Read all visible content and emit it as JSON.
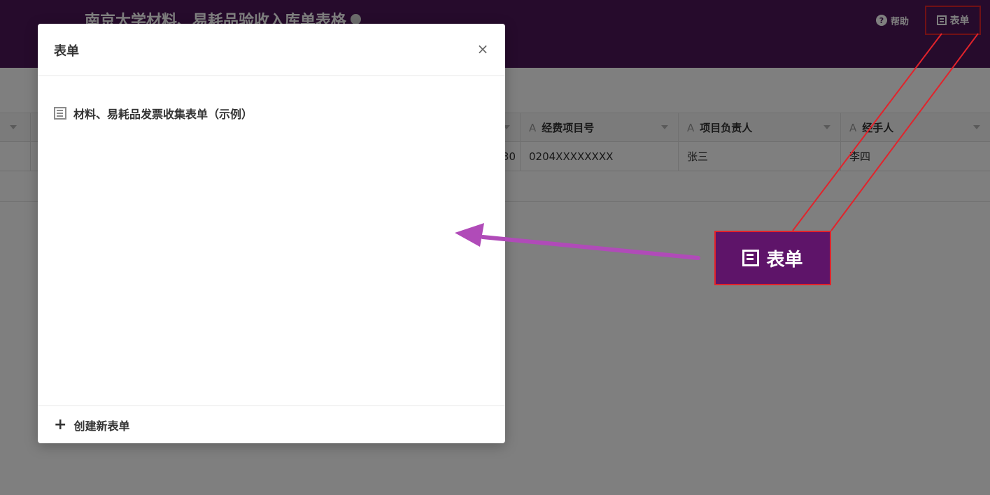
{
  "header": {
    "app_title": "南京大学材料、易耗品验收入库单表格",
    "help_label": "帮助",
    "form_button_label": "表单",
    "form_icon": "form-icon",
    "help_icon": "question-circle-icon"
  },
  "table": {
    "columns": [
      {
        "name": "",
        "type_icon": "A"
      },
      {
        "name": "经费项目号",
        "type_icon": "A"
      },
      {
        "name": "项目负责人",
        "type_icon": "A"
      },
      {
        "name": "经手人",
        "type_icon": "A"
      }
    ],
    "rows": [
      {
        "partial_left": "30",
        "cells": [
          "0204XXXXXXXX",
          "张三",
          "李四"
        ]
      }
    ]
  },
  "modal": {
    "title": "表单",
    "close_glyph": "×",
    "forms": [
      {
        "name": "材料、易耗品发票收集表单（示例）",
        "icon": "form-list-icon"
      }
    ],
    "create_label": "创建新表单",
    "create_glyph": "+"
  },
  "callout": {
    "label": "表单"
  },
  "colors": {
    "header_bg": "#4d1759",
    "callout_bg": "#5e1469",
    "highlight_border": "#e2232b",
    "arrow": "#b04bb8"
  }
}
